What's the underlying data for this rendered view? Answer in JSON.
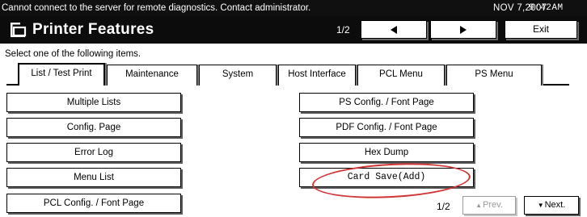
{
  "status_bar": {
    "message": "Cannot connect to the server for remote diagnostics. Contact administrator.",
    "date": "NOV   7,2007",
    "time": "9:42AM"
  },
  "title_bar": {
    "title": "Printer Features",
    "icon": "printer-icon",
    "page_indicator": "1/2",
    "back_icon": "left-arrow-icon",
    "forward_icon": "right-arrow-icon",
    "exit_label": "Exit"
  },
  "prompt": "Select one of the following items.",
  "tabs": [
    {
      "label": "List / Test Print",
      "active": true
    },
    {
      "label": "Maintenance",
      "active": false
    },
    {
      "label": "System",
      "active": false
    },
    {
      "label": "Host Interface",
      "active": false
    },
    {
      "label": "PCL Menu",
      "active": false
    },
    {
      "label": "PS Menu",
      "active": false
    }
  ],
  "left_items": [
    {
      "label": "Multiple Lists"
    },
    {
      "label": "Config. Page"
    },
    {
      "label": "Error Log"
    },
    {
      "label": "Menu List"
    },
    {
      "label": "PCL Config. / Font Page"
    }
  ],
  "right_items": [
    {
      "label": "PS Config. / Font Page"
    },
    {
      "label": "PDF Config. / Font Page"
    },
    {
      "label": "Hex Dump"
    },
    {
      "label": "Card Save(Add)",
      "highlighted": true
    }
  ],
  "pager": {
    "page": "1/2",
    "prev_label": "Prev.",
    "next_label": "Next.",
    "prev_enabled": false
  },
  "colors": {
    "title_bar_bg": "#0c0c0c",
    "highlight_ellipse": "#d23434"
  }
}
